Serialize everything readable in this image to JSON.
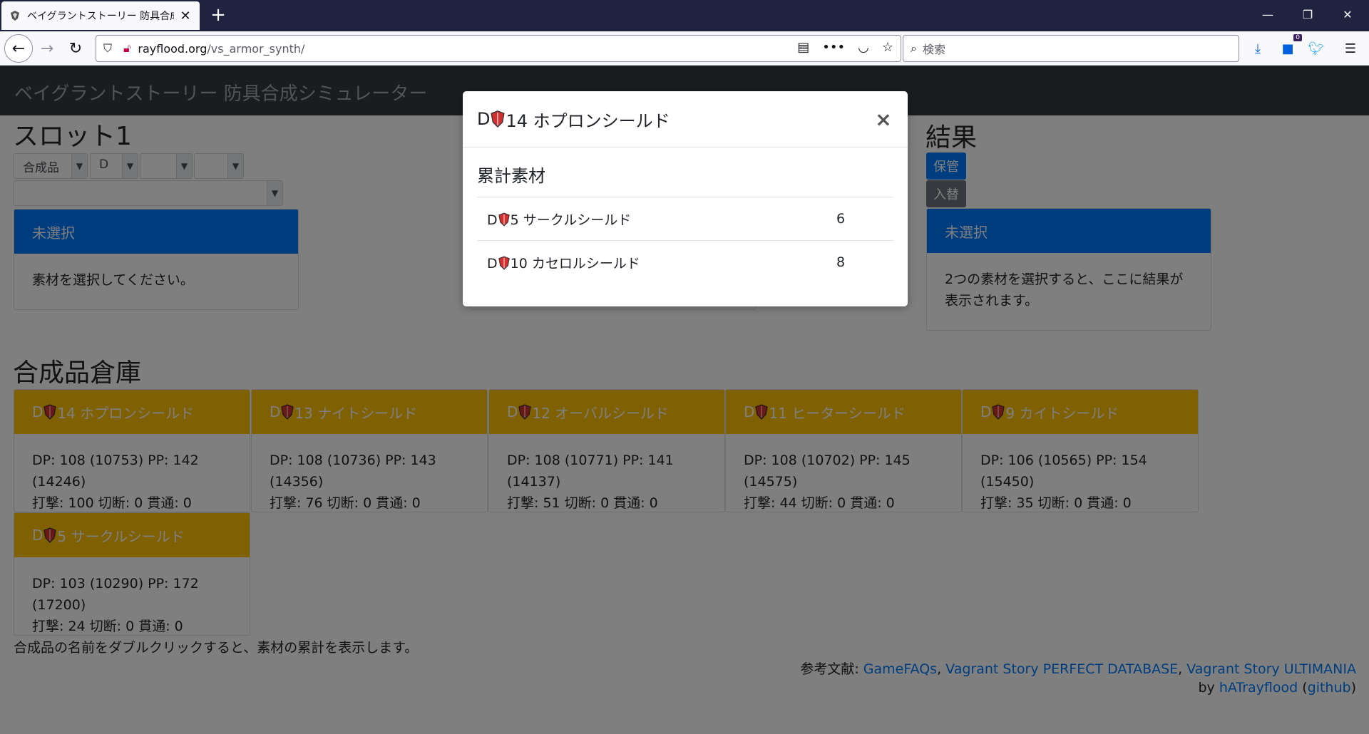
{
  "browser": {
    "tab_title": "ベイグラントストーリー 防具合成シミ",
    "url_domain": "rayflood.org",
    "url_path": "/vs_armor_synth/",
    "search_placeholder": "検索",
    "badge_count": "0"
  },
  "app": {
    "navbar_title": "ベイグラントストーリー 防具合成シミュレーター"
  },
  "slot1": {
    "heading": "スロット1",
    "selects": [
      "合成品",
      "D",
      "",
      ""
    ],
    "item_select": "",
    "card_header": "未選択",
    "card_body": "素材を選択してください。"
  },
  "result": {
    "heading": "結果",
    "save_label": "保管",
    "swap_label": "入替",
    "card_header": "未選択",
    "card_body": "2つの素材を選択すると、ここに結果が表示されます。"
  },
  "warehouse": {
    "heading": "合成品倉庫",
    "items": [
      {
        "prefix": "D",
        "name": "14 ホプロンシールド",
        "stats": "DP: 108 (10753) PP: 142 (14246)",
        "attrs": "打撃: 100 切断: 0 貫通: 0"
      },
      {
        "prefix": "D",
        "name": "13 ナイトシールド",
        "stats": "DP: 108 (10736) PP: 143 (14356)",
        "attrs": "打撃: 76 切断: 0 貫通: 0"
      },
      {
        "prefix": "D",
        "name": "12 オーバルシールド",
        "stats": "DP: 108 (10771) PP: 141 (14137)",
        "attrs": "打撃: 51 切断: 0 貫通: 0"
      },
      {
        "prefix": "D",
        "name": "11 ヒーターシールド",
        "stats": "DP: 108 (10702) PP: 145 (14575)",
        "attrs": "打撃: 44 切断: 0 貫通: 0"
      },
      {
        "prefix": "D",
        "name": "9 カイトシールド",
        "stats": "DP: 106 (10565) PP: 154 (15450)",
        "attrs": "打撃: 35 切断: 0 貫通: 0"
      },
      {
        "prefix": "D",
        "name": "5 サークルシールド",
        "stats": "DP: 103 (10290) PP: 172 (17200)",
        "attrs": "打撃: 24 切断: 0 貫通: 0"
      }
    ]
  },
  "footer": {
    "note": "合成品の名前をダブルクリックすると、素材の累計を表示します。",
    "refs_label": "参考文献: ",
    "ref1": "GameFAQs",
    "ref2": "Vagrant Story PERFECT DATABASE",
    "ref3": "Vagrant Story ULTIMANIA",
    "sep": ", ",
    "by_label": "by ",
    "author": "hATrayflood",
    "github_open": " (",
    "github": "github",
    "github_close": ")"
  },
  "modal": {
    "title_prefix": "D",
    "title_name": "14 ホプロンシールド",
    "close_glyph": "×",
    "subtitle": "累計素材",
    "rows": [
      {
        "prefix": "D",
        "name": "5 サークルシールド",
        "count": "6"
      },
      {
        "prefix": "D",
        "name": "10 カセロルシールド",
        "count": "8"
      }
    ]
  },
  "colors": {
    "primary": "#007bff",
    "warning": "#ffc107",
    "navbar": "#343a40",
    "shield_red": "#d32f2f"
  }
}
